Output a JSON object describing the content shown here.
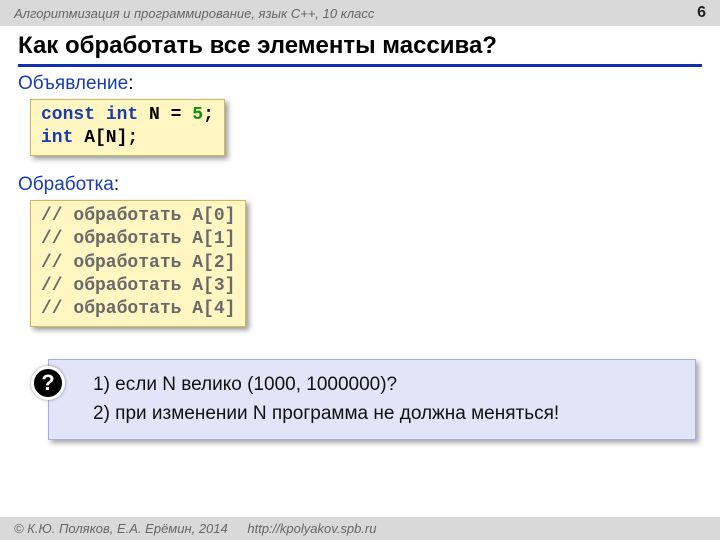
{
  "topbar": {
    "course": "Алгоритмизация и программирование, язык C++, 10 класс",
    "page": "6"
  },
  "title": "Как обработать все элементы массива?",
  "sections": {
    "declare_label": "Объявление",
    "process_label": "Обработка",
    "colon": ":"
  },
  "code_declare": {
    "kw_const": "const",
    "kw_int1": "int",
    "var_N": "N",
    "eq": " = ",
    "val": "5",
    "semi": ";",
    "kw_int2": "int",
    "arr": " A[N];"
  },
  "code_process": {
    "c0": "// обработать A[0]",
    "c1": "// обработать A[1]",
    "c2": "// обработать A[2]",
    "c3": "// обработать A[3]",
    "c4": "// обработать A[4]"
  },
  "question": {
    "badge": "?",
    "line1": "1) если N велико (1000, 1000000)?",
    "line2": "2) при изменении N программа не должна меняться!"
  },
  "footer": {
    "copyright": "© К.Ю. Поляков, Е.А. Ерёмин, 2014",
    "url": "http://kpolyakov.spb.ru"
  }
}
